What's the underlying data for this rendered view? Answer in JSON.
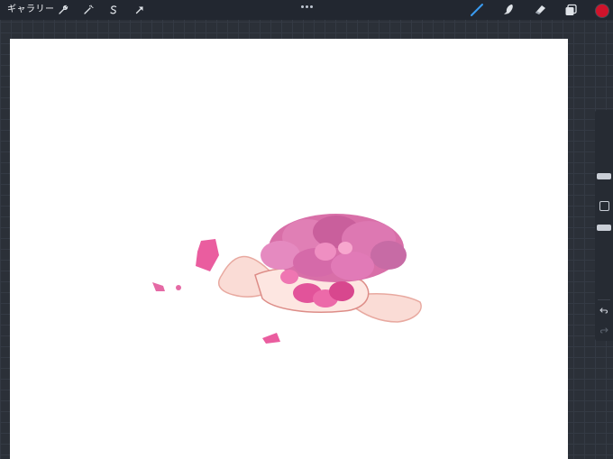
{
  "toolbar": {
    "gallery_label": "ギャラリー",
    "left_tools": [
      "wrench-icon",
      "magic-wand-icon",
      "selection-icon",
      "move-arrow-icon"
    ],
    "right_tools": [
      "brush-icon",
      "smudge-icon",
      "eraser-icon",
      "layers-icon"
    ],
    "active_tool": "brush-icon",
    "current_color": "#d0132b",
    "active_tool_color": "#3a9bf0"
  },
  "sidebar": {
    "controls": [
      "brush-size-slider",
      "modify-button",
      "opacity-slider",
      "undo-button",
      "redo-button"
    ]
  },
  "canvas": {
    "background": "#ffffff"
  }
}
